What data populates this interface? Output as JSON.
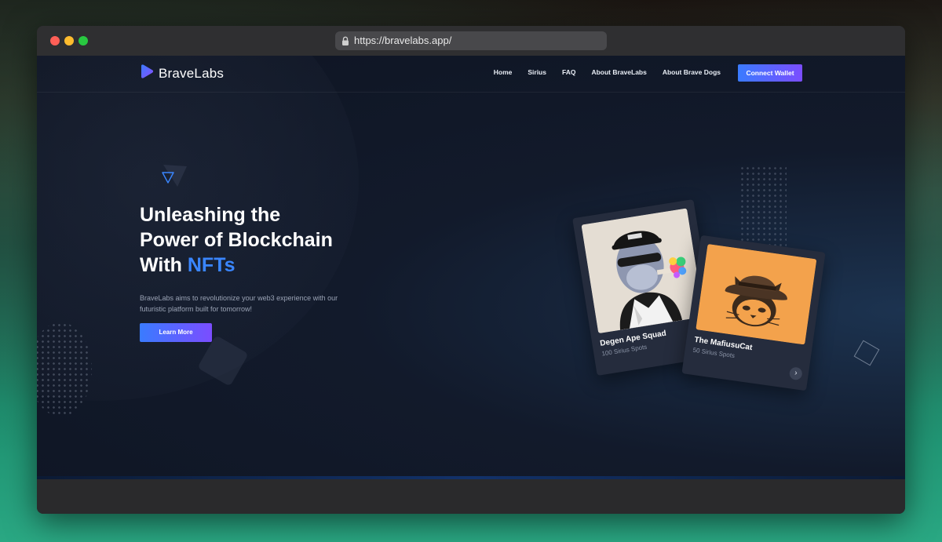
{
  "browser": {
    "url": "https://bravelabs.app/"
  },
  "nav": {
    "brand": "BraveLabs",
    "links": [
      "Home",
      "Sirius",
      "FAQ",
      "About BraveLabs",
      "About Brave Dogs"
    ],
    "connect_wallet": "Connect Wallet"
  },
  "hero": {
    "title_line1": "Unleashing the",
    "title_line2": "Power of Blockchain",
    "title_line3_prefix": "With ",
    "title_highlight": "NFTs",
    "description": "BraveLabs aims to revolutionize your web3 experience with our futuristic platform built for tomorrow!",
    "learn_more": "Learn More"
  },
  "cards": [
    {
      "title": "Degen Ape Squad",
      "subtitle": "100 Sirius Spots"
    },
    {
      "title": "The MafiusuCat",
      "subtitle": "50 Sirius Spots"
    }
  ],
  "colors": {
    "accent_blue": "#3a86ff",
    "gradient_start": "#3a7bff",
    "gradient_end": "#7b4dff",
    "page_bg": "#121a2b"
  },
  "icons": {
    "lock": "lock-icon",
    "logo": "bravelabs-logo-icon",
    "card_arrow": "chevron-right-icon"
  }
}
